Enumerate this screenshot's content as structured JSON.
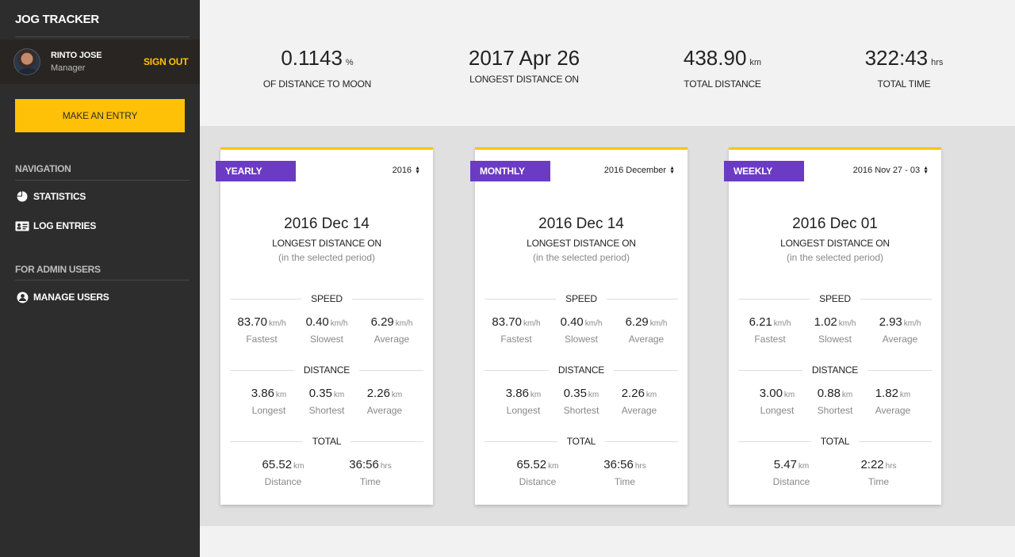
{
  "sidebar": {
    "brand": "JOG TRACKER",
    "user": {
      "name": "RINTO JOSE",
      "role": "Manager"
    },
    "signout": "SIGN OUT",
    "entry_button": "MAKE AN ENTRY",
    "nav_heading": "NAVIGATION",
    "nav": [
      {
        "label": "STATISTICS",
        "icon": "pie-chart-icon"
      },
      {
        "label": "LOG ENTRIES",
        "icon": "id-card-icon"
      }
    ],
    "admin_heading": "FOR ADMIN USERS",
    "admin": [
      {
        "label": "MANAGE USERS",
        "icon": "user-circle-icon"
      }
    ]
  },
  "summary": [
    {
      "value": "0.1143",
      "unit": "%",
      "label": "OF DISTANCE TO MOON"
    },
    {
      "value": "2017 Apr 26",
      "unit": "",
      "label": "LONGEST DISTANCE ON"
    },
    {
      "value": "438.90",
      "unit": "km",
      "label": "TOTAL DISTANCE"
    },
    {
      "value": "322:43",
      "unit": "hrs",
      "label": "TOTAL TIME"
    }
  ],
  "colors": {
    "accent": "#ffc107",
    "tag": "#6c3bc4",
    "sidebar": "#2d2d2d"
  },
  "cards": [
    {
      "tag": "YEARLY",
      "period": "2016",
      "date": "2016 Dec 14",
      "longest_label": "LONGEST DISTANCE ON",
      "sub": "(in the selected period)",
      "speed_heading": "SPEED",
      "speed": [
        {
          "value": "83.70",
          "unit": "km/h",
          "label": "Fastest"
        },
        {
          "value": "0.40",
          "unit": "km/h",
          "label": "Slowest"
        },
        {
          "value": "6.29",
          "unit": "km/h",
          "label": "Average"
        }
      ],
      "distance_heading": "DISTANCE",
      "distance": [
        {
          "value": "3.86",
          "unit": "km",
          "label": "Longest"
        },
        {
          "value": "0.35",
          "unit": "km",
          "label": "Shortest"
        },
        {
          "value": "2.26",
          "unit": "km",
          "label": "Average"
        }
      ],
      "total_heading": "TOTAL",
      "total": [
        {
          "value": "65.52",
          "unit": "km",
          "label": "Distance"
        },
        {
          "value": "36:56",
          "unit": "hrs",
          "label": "Time"
        }
      ]
    },
    {
      "tag": "MONTHLY",
      "period": "2016 December",
      "date": "2016 Dec 14",
      "longest_label": "LONGEST DISTANCE ON",
      "sub": "(in the selected period)",
      "speed_heading": "SPEED",
      "speed": [
        {
          "value": "83.70",
          "unit": "km/h",
          "label": "Fastest"
        },
        {
          "value": "0.40",
          "unit": "km/h",
          "label": "Slowest"
        },
        {
          "value": "6.29",
          "unit": "km/h",
          "label": "Average"
        }
      ],
      "distance_heading": "DISTANCE",
      "distance": [
        {
          "value": "3.86",
          "unit": "km",
          "label": "Longest"
        },
        {
          "value": "0.35",
          "unit": "km",
          "label": "Shortest"
        },
        {
          "value": "2.26",
          "unit": "km",
          "label": "Average"
        }
      ],
      "total_heading": "TOTAL",
      "total": [
        {
          "value": "65.52",
          "unit": "km",
          "label": "Distance"
        },
        {
          "value": "36:56",
          "unit": "hrs",
          "label": "Time"
        }
      ]
    },
    {
      "tag": "WEEKLY",
      "period": "2016 Nov 27 - 03",
      "date": "2016 Dec 01",
      "longest_label": "LONGEST DISTANCE ON",
      "sub": "(in the selected period)",
      "speed_heading": "SPEED",
      "speed": [
        {
          "value": "6.21",
          "unit": "km/h",
          "label": "Fastest"
        },
        {
          "value": "1.02",
          "unit": "km/h",
          "label": "Slowest"
        },
        {
          "value": "2.93",
          "unit": "km/h",
          "label": "Average"
        }
      ],
      "distance_heading": "DISTANCE",
      "distance": [
        {
          "value": "3.00",
          "unit": "km",
          "label": "Longest"
        },
        {
          "value": "0.88",
          "unit": "km",
          "label": "Shortest"
        },
        {
          "value": "1.82",
          "unit": "km",
          "label": "Average"
        }
      ],
      "total_heading": "TOTAL",
      "total": [
        {
          "value": "5.47",
          "unit": "km",
          "label": "Distance"
        },
        {
          "value": "2:22",
          "unit": "hrs",
          "label": "Time"
        }
      ]
    }
  ]
}
